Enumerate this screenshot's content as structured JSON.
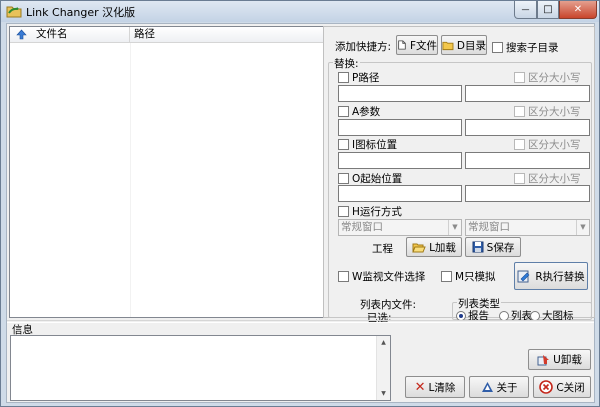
{
  "window": {
    "title": "Link Changer 汉化版",
    "controls": {
      "minimize": "—",
      "maximize": "□",
      "close": "✕"
    }
  },
  "filelist": {
    "columns": [
      "文件名",
      "路径"
    ]
  },
  "shortcut": {
    "add_label": "添加快捷方:",
    "file_btn": "F文件",
    "dir_btn": "D目录",
    "search_subdirs": "搜索子目录"
  },
  "replace": {
    "group_label": "替换:",
    "case_label": "区分大小写",
    "rows": [
      {
        "label": "P路径"
      },
      {
        "label": "A参数"
      },
      {
        "label": "I图标位置"
      },
      {
        "label": "O起始位置"
      }
    ],
    "run_mode_label": "H运行方式",
    "run_mode_value_left": "常规窗口",
    "run_mode_value_right": "常规窗口"
  },
  "project": {
    "label": "工程",
    "load_btn": "L加载",
    "save_btn": "S保存"
  },
  "options": {
    "monitor": "W监视文件选择",
    "simulate": "M只模拟",
    "run_replace_btn": "R执行替换"
  },
  "stats": {
    "line1": "列表内文件:",
    "line2": "已选:"
  },
  "listtype": {
    "label": "列表类型",
    "opt1": "报告",
    "opt2": "列表",
    "opt3": "大图标",
    "selected": "报告"
  },
  "info": {
    "label": "信息"
  },
  "buttons": {
    "uninstall": "U卸载",
    "clear": "L清除",
    "about": "关于",
    "close": "C关闭"
  },
  "colors": {
    "window_frame": "#cfdbe8",
    "client_bg": "#f0f0f0",
    "close_red": "#c9452c"
  }
}
